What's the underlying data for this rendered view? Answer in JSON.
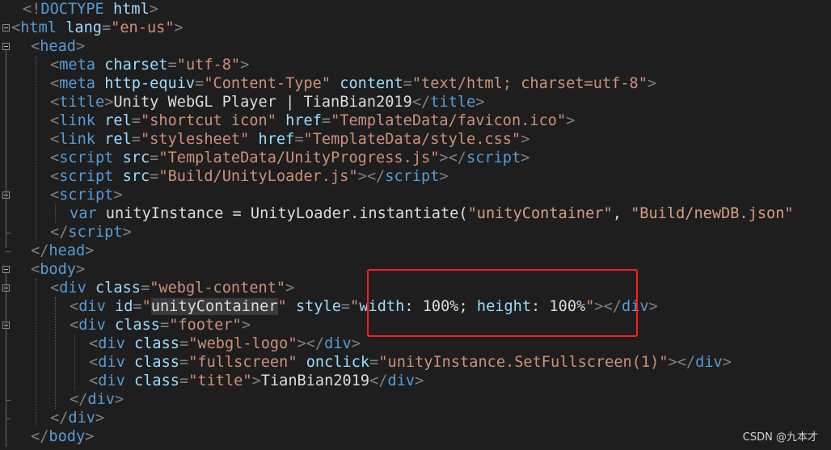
{
  "code_lines": [
    {
      "tokens": [
        {
          "t": "<!",
          "c": "punct"
        },
        {
          "t": "DOCTYPE",
          "c": "tag"
        },
        {
          "t": " html",
          "c": "attr"
        },
        {
          "t": ">",
          "c": "punct"
        }
      ]
    },
    {
      "tokens": [
        {
          "t": "<",
          "c": "punct"
        },
        {
          "t": "html",
          "c": "tag"
        },
        {
          "t": " ",
          "c": "text"
        },
        {
          "t": "lang",
          "c": "attr"
        },
        {
          "t": "=",
          "c": "punct"
        },
        {
          "t": "\"en-us\"",
          "c": "val"
        },
        {
          "t": ">",
          "c": "punct"
        }
      ]
    },
    {
      "tokens": [
        {
          "t": "<",
          "c": "punct"
        },
        {
          "t": "head",
          "c": "tag"
        },
        {
          "t": ">",
          "c": "punct"
        }
      ]
    },
    {
      "tokens": [
        {
          "t": "<",
          "c": "punct"
        },
        {
          "t": "meta",
          "c": "tag"
        },
        {
          "t": " ",
          "c": "text"
        },
        {
          "t": "charset",
          "c": "attr"
        },
        {
          "t": "=",
          "c": "punct"
        },
        {
          "t": "\"utf-8\"",
          "c": "val"
        },
        {
          "t": ">",
          "c": "punct"
        }
      ]
    },
    {
      "tokens": [
        {
          "t": "<",
          "c": "punct"
        },
        {
          "t": "meta",
          "c": "tag"
        },
        {
          "t": " ",
          "c": "text"
        },
        {
          "t": "http-equiv",
          "c": "attr"
        },
        {
          "t": "=",
          "c": "punct"
        },
        {
          "t": "\"Content-Type\"",
          "c": "val"
        },
        {
          "t": " ",
          "c": "text"
        },
        {
          "t": "content",
          "c": "attr"
        },
        {
          "t": "=",
          "c": "punct"
        },
        {
          "t": "\"text/html; charset=utf-8\"",
          "c": "val"
        },
        {
          "t": ">",
          "c": "punct"
        }
      ]
    },
    {
      "tokens": [
        {
          "t": "<",
          "c": "punct"
        },
        {
          "t": "title",
          "c": "tag"
        },
        {
          "t": ">",
          "c": "punct"
        },
        {
          "t": "Unity WebGL Player | TianBian2019",
          "c": "text"
        },
        {
          "t": "</",
          "c": "punct"
        },
        {
          "t": "title",
          "c": "tag"
        },
        {
          "t": ">",
          "c": "punct"
        }
      ]
    },
    {
      "tokens": [
        {
          "t": "<",
          "c": "punct"
        },
        {
          "t": "link",
          "c": "tag"
        },
        {
          "t": " ",
          "c": "text"
        },
        {
          "t": "rel",
          "c": "attr"
        },
        {
          "t": "=",
          "c": "punct"
        },
        {
          "t": "\"shortcut icon\"",
          "c": "val"
        },
        {
          "t": " ",
          "c": "text"
        },
        {
          "t": "href",
          "c": "attr"
        },
        {
          "t": "=",
          "c": "punct"
        },
        {
          "t": "\"TemplateData/favicon.ico\"",
          "c": "val"
        },
        {
          "t": ">",
          "c": "punct"
        }
      ]
    },
    {
      "tokens": [
        {
          "t": "<",
          "c": "punct"
        },
        {
          "t": "link",
          "c": "tag"
        },
        {
          "t": " ",
          "c": "text"
        },
        {
          "t": "rel",
          "c": "attr"
        },
        {
          "t": "=",
          "c": "punct"
        },
        {
          "t": "\"stylesheet\"",
          "c": "val"
        },
        {
          "t": " ",
          "c": "text"
        },
        {
          "t": "href",
          "c": "attr"
        },
        {
          "t": "=",
          "c": "punct"
        },
        {
          "t": "\"TemplateData/style.css\"",
          "c": "val"
        },
        {
          "t": ">",
          "c": "punct"
        }
      ]
    },
    {
      "tokens": [
        {
          "t": "<",
          "c": "punct"
        },
        {
          "t": "script",
          "c": "tag"
        },
        {
          "t": " ",
          "c": "text"
        },
        {
          "t": "src",
          "c": "attr"
        },
        {
          "t": "=",
          "c": "punct"
        },
        {
          "t": "\"TemplateData/UnityProgress.js\"",
          "c": "val"
        },
        {
          "t": "></",
          "c": "punct"
        },
        {
          "t": "script",
          "c": "tag"
        },
        {
          "t": ">",
          "c": "punct"
        }
      ]
    },
    {
      "tokens": [
        {
          "t": "<",
          "c": "punct"
        },
        {
          "t": "script",
          "c": "tag"
        },
        {
          "t": " ",
          "c": "text"
        },
        {
          "t": "src",
          "c": "attr"
        },
        {
          "t": "=",
          "c": "punct"
        },
        {
          "t": "\"Build/UnityLoader.js\"",
          "c": "val"
        },
        {
          "t": "></",
          "c": "punct"
        },
        {
          "t": "script",
          "c": "tag"
        },
        {
          "t": ">",
          "c": "punct"
        }
      ]
    },
    {
      "tokens": [
        {
          "t": "<",
          "c": "punct"
        },
        {
          "t": "script",
          "c": "tag"
        },
        {
          "t": ">",
          "c": "punct"
        }
      ]
    },
    {
      "tokens": [
        {
          "t": "var",
          "c": "kw"
        },
        {
          "t": " unityInstance = UnityLoader.instantiate(",
          "c": "ident"
        },
        {
          "t": "\"unityContainer\"",
          "c": "str"
        },
        {
          "t": ", ",
          "c": "ident"
        },
        {
          "t": "\"Build/newDB.json\"",
          "c": "str"
        }
      ]
    },
    {
      "tokens": [
        {
          "t": "</",
          "c": "punct"
        },
        {
          "t": "script",
          "c": "tag"
        },
        {
          "t": ">",
          "c": "punct"
        }
      ]
    },
    {
      "tokens": [
        {
          "t": "</",
          "c": "punct"
        },
        {
          "t": "head",
          "c": "tag"
        },
        {
          "t": ">",
          "c": "punct"
        }
      ]
    },
    {
      "tokens": [
        {
          "t": "<",
          "c": "punct"
        },
        {
          "t": "body",
          "c": "tag"
        },
        {
          "t": ">",
          "c": "punct"
        }
      ]
    },
    {
      "tokens": [
        {
          "t": "<",
          "c": "punct"
        },
        {
          "t": "div",
          "c": "tag"
        },
        {
          "t": " ",
          "c": "text"
        },
        {
          "t": "class",
          "c": "attr"
        },
        {
          "t": "=",
          "c": "punct"
        },
        {
          "t": "\"webgl-content\"",
          "c": "val"
        },
        {
          "t": ">",
          "c": "punct"
        }
      ]
    },
    {
      "tokens": [
        {
          "t": "<",
          "c": "punct"
        },
        {
          "t": "div",
          "c": "tag"
        },
        {
          "t": " ",
          "c": "text"
        },
        {
          "t": "id",
          "c": "attr"
        },
        {
          "t": "=",
          "c": "punct"
        },
        {
          "t": "\"",
          "c": "val"
        },
        {
          "t": "unityContainer",
          "c": "hl"
        },
        {
          "t": "\"",
          "c": "val"
        },
        {
          "t": " ",
          "c": "text"
        },
        {
          "t": "style",
          "c": "attr"
        },
        {
          "t": "=",
          "c": "punct"
        },
        {
          "t": "\"",
          "c": "val"
        },
        {
          "t": "width",
          "c": "attr"
        },
        {
          "t": ": 100%; ",
          "c": "text"
        },
        {
          "t": "height",
          "c": "attr"
        },
        {
          "t": ": 100%",
          "c": "text"
        },
        {
          "t": "\"",
          "c": "val"
        },
        {
          "t": "></",
          "c": "punct"
        },
        {
          "t": "div",
          "c": "tag"
        },
        {
          "t": ">",
          "c": "punct"
        }
      ]
    },
    {
      "tokens": [
        {
          "t": "<",
          "c": "punct"
        },
        {
          "t": "div",
          "c": "tag"
        },
        {
          "t": " ",
          "c": "text"
        },
        {
          "t": "class",
          "c": "attr"
        },
        {
          "t": "=",
          "c": "punct"
        },
        {
          "t": "\"footer\"",
          "c": "val"
        },
        {
          "t": ">",
          "c": "punct"
        }
      ]
    },
    {
      "tokens": [
        {
          "t": "<",
          "c": "punct"
        },
        {
          "t": "div",
          "c": "tag"
        },
        {
          "t": " ",
          "c": "text"
        },
        {
          "t": "class",
          "c": "attr"
        },
        {
          "t": "=",
          "c": "punct"
        },
        {
          "t": "\"webgl-logo\"",
          "c": "val"
        },
        {
          "t": "></",
          "c": "punct"
        },
        {
          "t": "div",
          "c": "tag"
        },
        {
          "t": ">",
          "c": "punct"
        }
      ]
    },
    {
      "tokens": [
        {
          "t": "<",
          "c": "punct"
        },
        {
          "t": "div",
          "c": "tag"
        },
        {
          "t": " ",
          "c": "text"
        },
        {
          "t": "class",
          "c": "attr"
        },
        {
          "t": "=",
          "c": "punct"
        },
        {
          "t": "\"fullscreen\"",
          "c": "val"
        },
        {
          "t": " ",
          "c": "text"
        },
        {
          "t": "onclick",
          "c": "attr"
        },
        {
          "t": "=",
          "c": "punct"
        },
        {
          "t": "\"unityInstance.SetFullscreen(1)\"",
          "c": "val"
        },
        {
          "t": "></",
          "c": "punct"
        },
        {
          "t": "div",
          "c": "tag"
        },
        {
          "t": ">",
          "c": "punct"
        }
      ]
    },
    {
      "tokens": [
        {
          "t": "<",
          "c": "punct"
        },
        {
          "t": "div",
          "c": "tag"
        },
        {
          "t": " ",
          "c": "text"
        },
        {
          "t": "class",
          "c": "attr"
        },
        {
          "t": "=",
          "c": "punct"
        },
        {
          "t": "\"title\"",
          "c": "val"
        },
        {
          "t": ">",
          "c": "punct"
        },
        {
          "t": "TianBian2019",
          "c": "text"
        },
        {
          "t": "</",
          "c": "punct"
        },
        {
          "t": "div",
          "c": "tag"
        },
        {
          "t": ">",
          "c": "punct"
        }
      ]
    },
    {
      "tokens": [
        {
          "t": "</",
          "c": "punct"
        },
        {
          "t": "div",
          "c": "tag"
        },
        {
          "t": ">",
          "c": "punct"
        }
      ]
    },
    {
      "tokens": [
        {
          "t": "</",
          "c": "punct"
        },
        {
          "t": "div",
          "c": "tag"
        },
        {
          "t": ">",
          "c": "punct"
        }
      ]
    },
    {
      "tokens": [
        {
          "t": "</",
          "c": "punct"
        },
        {
          "t": "body",
          "c": "tag"
        },
        {
          "t": ">",
          "c": "punct"
        }
      ]
    }
  ],
  "watermark": "CSDN @九本才",
  "colors": {
    "background": "#1e1e1e",
    "punctuation": "#808080",
    "tag": "#569cd6",
    "attribute": "#9cdcfe",
    "value": "#ce9178",
    "highlight_box": "#ff1f1f"
  }
}
